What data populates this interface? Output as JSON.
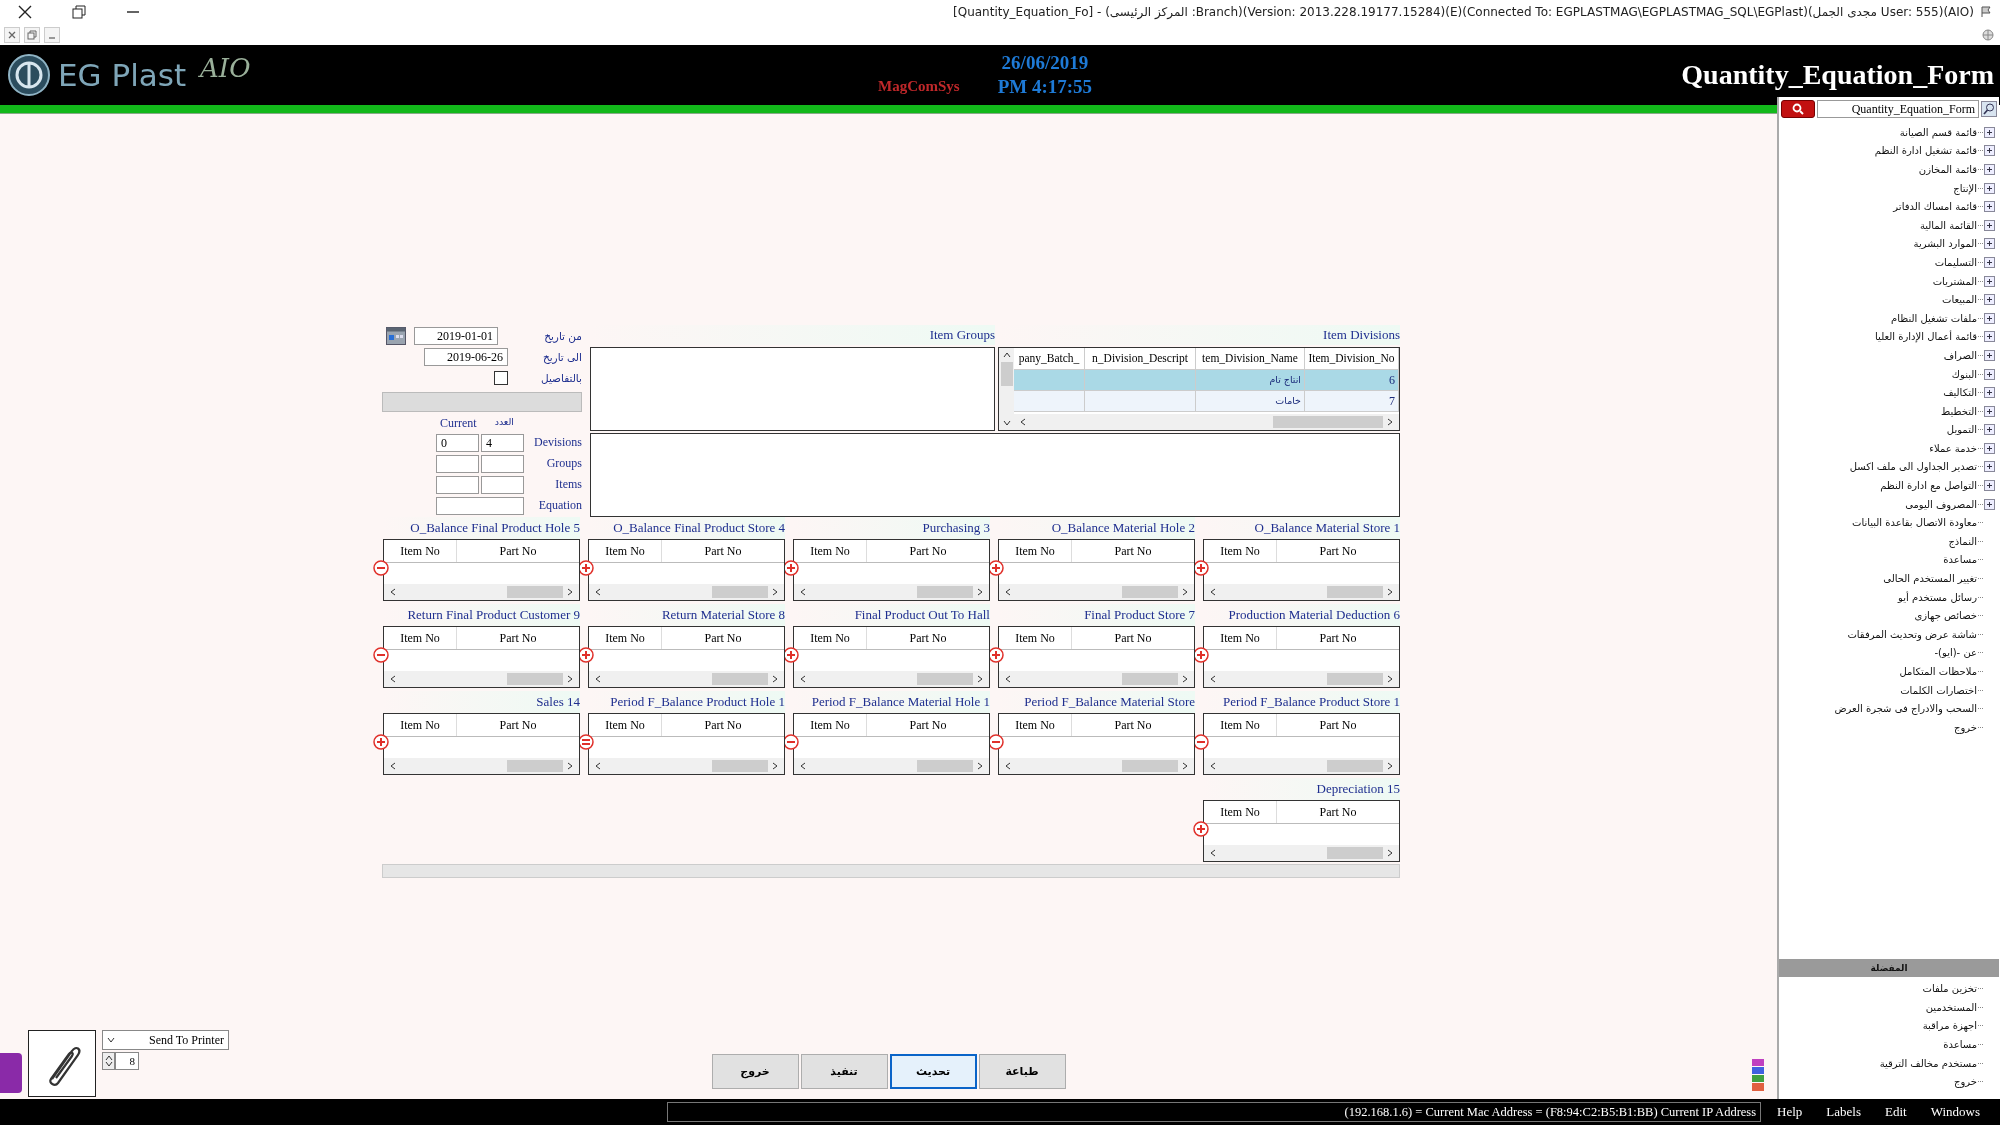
{
  "title_bar": {
    "title": "[Quantity_Equation_Fo] - (المركز الرئيسى :Branch)(Version: 2013.228.19177.15284)(E)(Connected To: EGPLASTMAG\\EGPLASTMAG_SQL\\EGPlast)(مجدى الجمل User: 555)(AIO)"
  },
  "header": {
    "logo_text": "EG Plast",
    "logo_suffix": "AIO",
    "brand": "MagComSys",
    "date": "26/06/2019",
    "time": "PM 4:17:55",
    "form_title": "Quantity_Equation_Form"
  },
  "item_divisions": {
    "title": "Item Divisions",
    "columns": [
      "Item_Division_No",
      "tem_Division_Name",
      "n_Division_Descript",
      "pany_Batch_"
    ],
    "rows": [
      {
        "item_division_no": "6",
        "item_division_name": "انتاج تام",
        "selected": true
      },
      {
        "item_division_no": "7",
        "item_division_name": "خامات",
        "selected": false
      }
    ]
  },
  "item_groups": {
    "title": "Item Groups"
  },
  "filters": {
    "from_label": "من تاريخ",
    "from_value": "2019-01-01",
    "to_label": "الى تاريخ",
    "to_value": "2019-06-26",
    "details_label": "بالتفاصيل",
    "details_checked": false
  },
  "counts": {
    "count_heading": "العدد",
    "current_heading": "Current",
    "rows": [
      {
        "label": "Devisions",
        "count": "4",
        "current": "0"
      },
      {
        "label": "Groups"
      },
      {
        "label": "Items"
      }
    ],
    "equation_label": "Equation"
  },
  "grid_rows": [
    [
      {
        "title": "O_Balance Material Store 1",
        "kind": "plus",
        "columns": [
          "Part No",
          "Item No"
        ]
      },
      {
        "title": "O_Balance Material Hole 2",
        "kind": "plus",
        "columns": [
          "Part No",
          "Item No"
        ]
      },
      {
        "title": "Purchasing 3",
        "kind": "plus",
        "columns": [
          "Part No",
          "Item No"
        ]
      },
      {
        "title": "O_Balance Final Product Store 4",
        "kind": "plus",
        "columns": [
          "Part No",
          "Item No"
        ]
      },
      {
        "title": "O_Balance Final Product Hole 5",
        "kind": "minus",
        "columns": [
          "Part No",
          "Item No"
        ]
      }
    ],
    [
      {
        "title": "Production Material Deduction 6",
        "kind": "plus",
        "columns": [
          "Part No",
          "Item No"
        ]
      },
      {
        "title": "Final Product Store 7",
        "kind": "plus",
        "columns": [
          "Part No",
          "Item No"
        ]
      },
      {
        "title": "Final Product Out To Hall",
        "kind": "plus",
        "columns": [
          "Part No",
          "Item No"
        ]
      },
      {
        "title": "Return Material Store 8",
        "kind": "plus",
        "columns": [
          "Part No",
          "Item No"
        ]
      },
      {
        "title": "Return Final Product Customer 9",
        "kind": "minus",
        "columns": [
          "Part No",
          "Item No"
        ]
      }
    ],
    [
      {
        "title": "Period F_Balance Product Store 1",
        "kind": "minus",
        "columns": [
          "Part No",
          "Item No"
        ]
      },
      {
        "title": "Period F_Balance Material Store",
        "kind": "minus",
        "columns": [
          "Part No",
          "Item No"
        ]
      },
      {
        "title": "Period F_Balance Material Hole 1",
        "kind": "minus",
        "columns": [
          "Part No",
          "Item No"
        ]
      },
      {
        "title": "Period F_Balance Product Hole 1",
        "kind": "equals",
        "columns": [
          "Part No",
          "Item No"
        ]
      },
      {
        "title": "Sales 14",
        "kind": "plus",
        "columns": [
          "Part No",
          "Item No"
        ]
      }
    ],
    [
      {
        "title": "Depreciation 15",
        "kind": "plus",
        "columns": [
          "Part No",
          "Item No"
        ]
      }
    ]
  ],
  "bottom": {
    "buttons": [
      {
        "label": "طباعة",
        "selected": false
      },
      {
        "label": "تحديث",
        "selected": true
      },
      {
        "label": "تنفيذ",
        "selected": false
      },
      {
        "label": "خروج",
        "selected": false
      }
    ],
    "printer_option": "Send To Printer",
    "copies": "8"
  },
  "sidebar": {
    "search_value": "Quantity_Equation_Form",
    "tree": [
      {
        "label": "قائمة قسم الصيانة",
        "kind": "group"
      },
      {
        "label": "قائمة تشغيل ادارة النظم",
        "kind": "group"
      },
      {
        "label": "قائمة المخازن",
        "kind": "group"
      },
      {
        "label": "الإنتاج",
        "kind": "group"
      },
      {
        "label": "قائمة امساك الدفاتر",
        "kind": "group"
      },
      {
        "label": "القائمة المالية",
        "kind": "group"
      },
      {
        "label": "الموارد البشرية",
        "kind": "group"
      },
      {
        "label": "التسليمات",
        "kind": "group"
      },
      {
        "label": "المشتريات",
        "kind": "group"
      },
      {
        "label": "المبيعات",
        "kind": "group"
      },
      {
        "label": "ملفات تشغيل النظام",
        "kind": "group"
      },
      {
        "label": "قائمة أعمال الإدارة العليا",
        "kind": "group"
      },
      {
        "label": "الصراف",
        "kind": "group"
      },
      {
        "label": "البنوك",
        "kind": "group"
      },
      {
        "label": "التكاليف",
        "kind": "group"
      },
      {
        "label": "التخطيط",
        "kind": "group"
      },
      {
        "label": "التمويل",
        "kind": "group"
      },
      {
        "label": "خدمة عملاء",
        "kind": "group"
      },
      {
        "label": "تصدير الجداول الى ملف اكسل",
        "kind": "group"
      },
      {
        "label": "التواصل مع ادارة النظم",
        "kind": "group"
      },
      {
        "label": "المصروف اليومى",
        "kind": "group"
      },
      {
        "label": "معاودة الاتصال بقاعدة البيانات",
        "kind": "leaf"
      },
      {
        "label": "النماذج",
        "kind": "leaf"
      },
      {
        "label": "مساعدة",
        "kind": "leaf"
      },
      {
        "label": "تغيير المستخدم الحالى",
        "kind": "leaf"
      },
      {
        "label": "رسائل مستخدم أيو",
        "kind": "leaf"
      },
      {
        "label": "خصائص جهازى",
        "kind": "leaf"
      },
      {
        "label": "شاشة عرض وتحديث المرفقات",
        "kind": "leaf"
      },
      {
        "label": "عن -(ايو)-",
        "kind": "leaf"
      },
      {
        "label": "ملاحظات المتكامل",
        "kind": "leaf"
      },
      {
        "label": "اختصارات الكلمات",
        "kind": "leaf"
      },
      {
        "label": "السحب والادراج فى شجرة العرض",
        "kind": "leaf"
      },
      {
        "label": "خروج",
        "kind": "leaf"
      }
    ],
    "favorites_title": "المفضلة",
    "favorites": [
      "تخزين ملفات",
      "المستخدمين",
      "اجهزة مراقبة",
      "مساعدة",
      "مستخدم مخالف الترقية",
      "خروج"
    ]
  },
  "status_bar": {
    "menus": [
      "Windows",
      "Edit",
      "Labels",
      "Help"
    ],
    "network": "(192.168.1.6) = Current Mac Address = (F8:94:C2:B5:B1:BB) Current IP Address"
  }
}
